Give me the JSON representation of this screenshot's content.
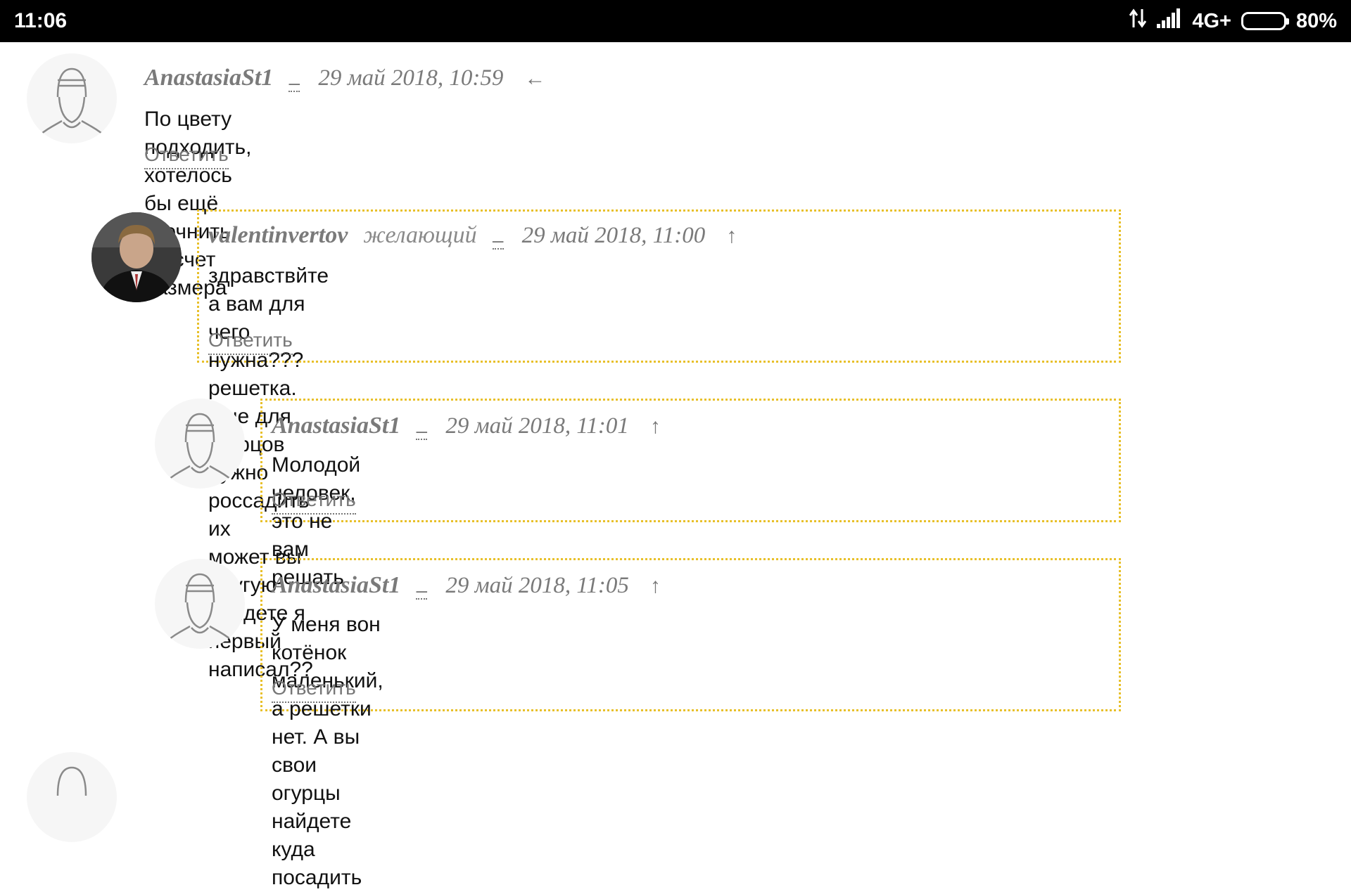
{
  "status_bar": {
    "time": "11:06",
    "network": "4G+",
    "battery": "80%",
    "battery_level": 0.8
  },
  "comments": [
    {
      "author": "AnastasiaSt1",
      "role": "",
      "dash": "–",
      "date": "29 май 2018, 10:59",
      "arrow": "←",
      "text": "По цвету подходить, хотелось бы ещё уточнить на счет размера",
      "reply": "Ответить",
      "avatar": "default-user-icon"
    },
    {
      "author": "valentinvertov",
      "role": "желающий",
      "dash": "–",
      "date": "29 май 2018, 11:00",
      "arrow": "↑",
      "text_lines": [
        "здравствйте а вам для чего нужна??? решетка. Мне для огурцов нужно россадить их",
        "может вы другую найдете я первый написал??"
      ],
      "reply": "Ответить",
      "avatar": "user-photo"
    },
    {
      "author": "AnastasiaSt1",
      "role": "",
      "dash": "–",
      "date": "29 май 2018, 11:01",
      "arrow": "↑",
      "text": "Молодой человек, это не вам решать",
      "reply": "Ответить",
      "avatar": "default-user-icon"
    },
    {
      "author": "AnastasiaSt1",
      "role": "",
      "dash": "–",
      "date": "29 май 2018, 11:05",
      "arrow": "↑",
      "text_lines": [
        "У меня вон котёнок маленький, а решетки нет. А вы свои огурцы найдете куда",
        "посадить"
      ],
      "reply": "Ответить",
      "avatar": "default-user-icon"
    }
  ],
  "colors": {
    "highlight_border": "#e8c02a",
    "meta_text": "#7a7a7a",
    "body_text": "#111111"
  }
}
